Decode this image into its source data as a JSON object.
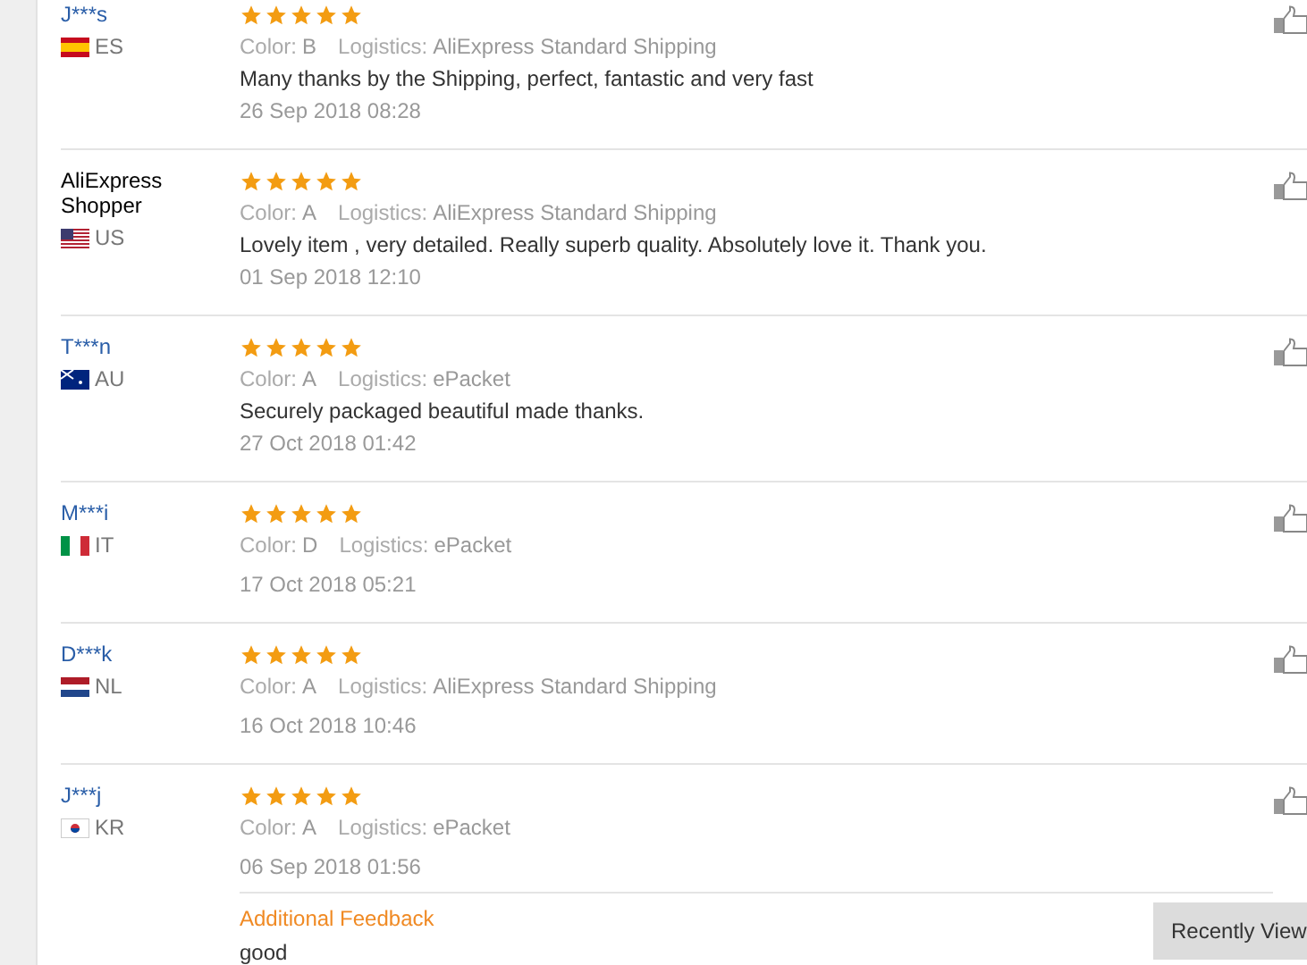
{
  "reviews": [
    {
      "name": "J***s",
      "linked": true,
      "country": "ES",
      "stars": 5,
      "variant_label": "Color:",
      "variant": "B",
      "logistics_label": "Logistics:",
      "logistics": "AliExpress Standard Shipping",
      "comment": "Many thanks by the Shipping, perfect, fantastic and very fast",
      "date": "26 Sep 2018 08:28"
    },
    {
      "name": "AliExpress Shopper",
      "linked": false,
      "country": "US",
      "stars": 5,
      "variant_label": "Color:",
      "variant": "A",
      "logistics_label": "Logistics:",
      "logistics": "AliExpress Standard Shipping",
      "comment": "Lovely item , very detailed. Really superb quality. Absolutely love it. Thank you.",
      "date": "01 Sep 2018 12:10"
    },
    {
      "name": "T***n",
      "linked": true,
      "country": "AU",
      "stars": 5,
      "variant_label": "Color:",
      "variant": "A",
      "logistics_label": "Logistics:",
      "logistics": "ePacket",
      "comment": "Securely packaged beautiful made thanks.",
      "date": "27 Oct 2018 01:42"
    },
    {
      "name": "M***i",
      "linked": true,
      "country": "IT",
      "stars": 5,
      "variant_label": "Color:",
      "variant": "D",
      "logistics_label": "Logistics:",
      "logistics": "ePacket",
      "date": "17 Oct 2018 05:21"
    },
    {
      "name": "D***k",
      "linked": true,
      "country": "NL",
      "stars": 5,
      "variant_label": "Color:",
      "variant": "A",
      "logistics_label": "Logistics:",
      "logistics": "AliExpress Standard Shipping",
      "date": "16 Oct 2018 10:46"
    },
    {
      "name": "J***j",
      "linked": true,
      "country": "KR",
      "stars": 5,
      "variant_label": "Color:",
      "variant": "A",
      "logistics_label": "Logistics:",
      "logistics": "ePacket",
      "date": "06 Sep 2018 01:56",
      "additional": {
        "title": "Additional Feedback",
        "text": "good"
      }
    }
  ],
  "recently_viewed": "Recently View"
}
